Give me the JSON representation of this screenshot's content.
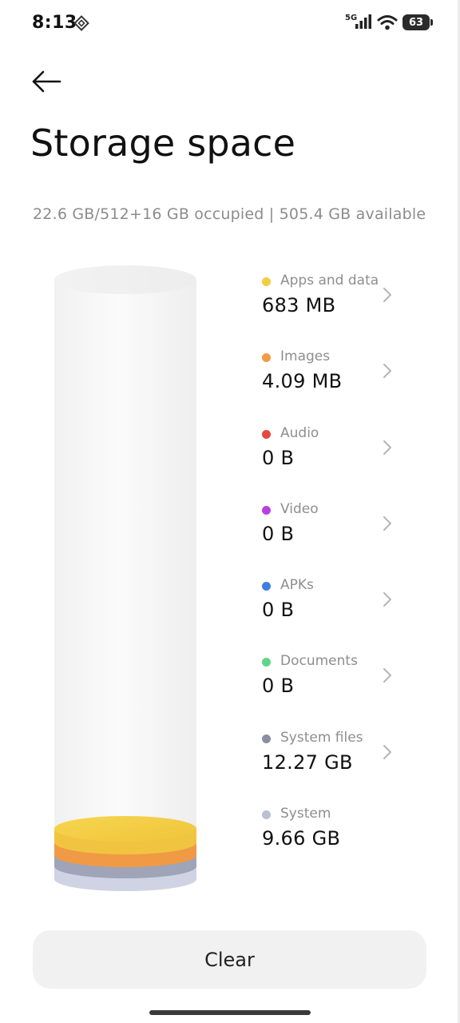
{
  "status_bar": {
    "time": "8:13",
    "network": "5G",
    "battery": "63"
  },
  "header": {
    "back_icon": "arrow-left-icon",
    "title": "Storage space"
  },
  "summary": "22.6 GB/512+16 GB occupied | 505.4 GB available",
  "categories": [
    {
      "label": "Apps and data",
      "value": "683 MB",
      "color": "#f3cd3f",
      "chevron": true
    },
    {
      "label": "Images",
      "value": "4.09 MB",
      "color": "#f39a46",
      "chevron": true
    },
    {
      "label": "Audio",
      "value": "0 B",
      "color": "#e5483e",
      "chevron": true
    },
    {
      "label": "Video",
      "value": "0 B",
      "color": "#b93fe0",
      "chevron": true
    },
    {
      "label": "APKs",
      "value": "0 B",
      "color": "#3f7ee0",
      "chevron": true
    },
    {
      "label": "Documents",
      "value": "0 B",
      "color": "#5fd58a",
      "chevron": true
    },
    {
      "label": "System files",
      "value": "12.27 GB",
      "color": "#8a8fa3",
      "chevron": true
    },
    {
      "label": "System",
      "value": "9.66 GB",
      "color": "#b9bfd4",
      "chevron": false
    }
  ],
  "actions": {
    "clear_label": "Clear"
  }
}
